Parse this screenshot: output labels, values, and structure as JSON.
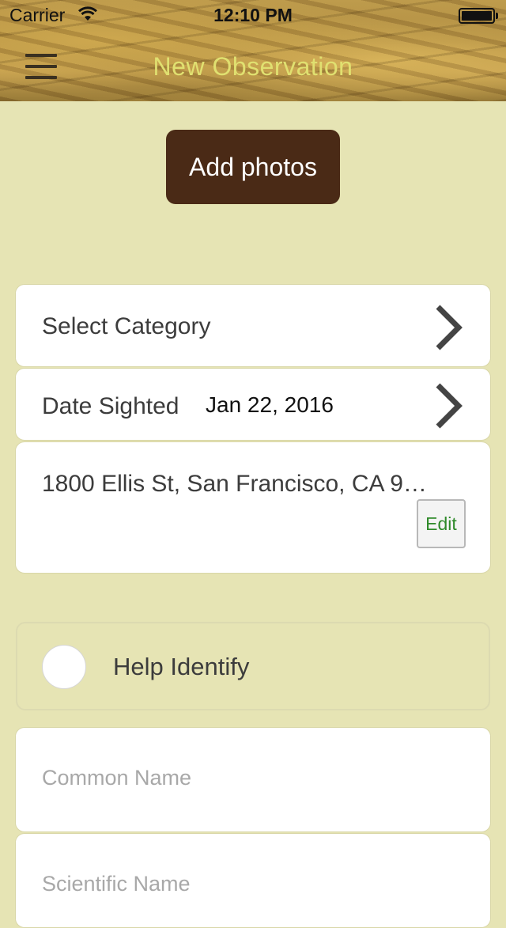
{
  "status_bar": {
    "carrier": "Carrier",
    "time": "12:10 PM"
  },
  "nav": {
    "title": "New Observation",
    "menu_icon": "hamburger-menu-icon"
  },
  "add_photos": {
    "label": "Add photos"
  },
  "category_row": {
    "label": "Select Category",
    "icon": "chevron-right-icon"
  },
  "date_row": {
    "label": "Date Sighted",
    "value": "Jan 22, 2016",
    "icon": "chevron-right-icon"
  },
  "location_row": {
    "address": "1800 Ellis St, San Francisco, CA 9…",
    "edit_label": "Edit"
  },
  "help_identify": {
    "label": "Help Identify",
    "checked": false
  },
  "fields": {
    "common_name_placeholder": "Common Name",
    "scientific_name_placeholder": "Scientific Name"
  },
  "colors": {
    "background": "#e6e4b4",
    "title": "#e0e070",
    "button_bg": "#4a2a16",
    "edit_text": "#2f8a2a"
  }
}
